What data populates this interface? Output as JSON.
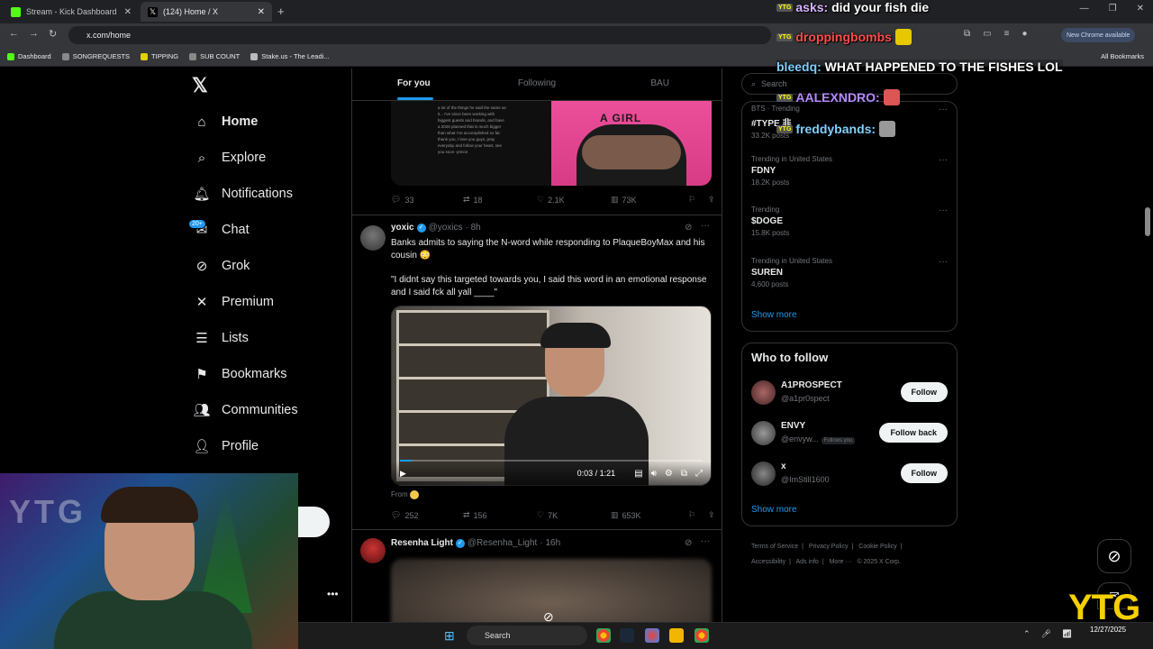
{
  "browser": {
    "tabs": [
      {
        "title": "Stream - Kick Dashboard",
        "color": "#53fc18"
      },
      {
        "title": "(124) Home / X",
        "color": "#ffffff"
      }
    ],
    "url": "x.com/home",
    "new_chrome": "New Chrome available",
    "bookmarks": [
      "Dashboard",
      "SONGREQUESTS",
      "TIPPING",
      "SUB COUNT",
      "Stake.us - The Leadi..."
    ],
    "all_bookmarks": "All Bookmarks"
  },
  "nav": {
    "items": [
      {
        "label": "Home",
        "icon": "home-icon"
      },
      {
        "label": "Explore",
        "icon": "search-icon"
      },
      {
        "label": "Notifications",
        "icon": "bell-icon"
      },
      {
        "label": "Chat",
        "icon": "mail-icon"
      },
      {
        "label": "Grok",
        "icon": "grok-icon"
      },
      {
        "label": "Premium",
        "icon": "x-icon"
      },
      {
        "label": "Lists",
        "icon": "list-icon"
      },
      {
        "label": "Bookmarks",
        "icon": "bookmark-icon"
      },
      {
        "label": "Communities",
        "icon": "people-icon"
      },
      {
        "label": "Profile",
        "icon": "person-icon"
      }
    ],
    "chat_badge": "20+"
  },
  "feed": {
    "tabs": [
      "For you",
      "Following",
      "BAU"
    ],
    "top_post": {
      "image_text": "a lot of the things he said the same as it... I've since been working with biggest guests and brands, and have a 2026 planned that is much bigger than what I've accomplished so far. thank you, I love you guys, pray everyday and follow your heart, see you soon -prince",
      "shirt_text": "A GIRL",
      "replies": "33",
      "reposts": "18",
      "likes": "2.1K",
      "views": "73K"
    },
    "tweet": {
      "name": "yoxic",
      "handle": "@yoxics",
      "time": "· 8h",
      "text": "Banks admits to saying the N-word while responding to PlaqueBoyMax and his cousin 😳",
      "quote": "\"I didnt say this targeted towards you, I said this word in an emotional response and I said fck all yall ____\"",
      "video_time": "0:03 / 1:21",
      "video_progress": 0.04,
      "from_label": "From",
      "replies": "252",
      "reposts": "156",
      "likes": "7K",
      "views": "653K"
    },
    "tweet2": {
      "name": "Resenha Light",
      "handle": "@Resenha_Light",
      "time": "· 16h"
    }
  },
  "sidebar": {
    "search_placeholder": "Search",
    "trends": [
      {
        "context": "BTS · Trending",
        "title": "#TYPE 非",
        "count": "33.2K posts"
      },
      {
        "context": "Trending in United States",
        "title": "FDNY",
        "count": "18.2K posts"
      },
      {
        "context": "Trending",
        "title": "$DOGE",
        "count": "15.8K posts"
      },
      {
        "context": "Trending in United States",
        "title": "SUREN",
        "count": "4,600 posts"
      }
    ],
    "show_more": "Show more",
    "who_to_follow_title": "Who to follow",
    "who_to_follow": [
      {
        "name": "A1PROSPECT",
        "handle": "@a1pr0spect",
        "button": "Follow",
        "follows_you": ""
      },
      {
        "name": "ENVY",
        "handle": "@envyw...",
        "button": "Follow back",
        "follows_you": "Follows you"
      },
      {
        "name": "x",
        "handle": "@ImStill1600",
        "button": "Follow",
        "follows_you": ""
      }
    ],
    "show_more_2": "Show more",
    "footer": [
      "Terms of Service",
      "|",
      "Privacy Policy",
      "|",
      "Cookie Policy",
      "|",
      "Accessibility",
      "|",
      "Ads info",
      "|",
      "More ···",
      "© 2025 X Corp."
    ]
  },
  "stream_chat": [
    {
      "user": "asks:",
      "message": "did your fish die",
      "badge": "YTG"
    },
    {
      "user": "droppingbombs",
      "message": "",
      "badge": "YTG"
    },
    {
      "user": "bleedq:",
      "message": "WHAT HAPPENED TO THE FISHES LOL",
      "badge": ""
    },
    {
      "user": "AALEXNDRO:",
      "message": "",
      "badge": "YTG"
    },
    {
      "user": "freddybands:",
      "message": "",
      "badge": "YTG"
    }
  ],
  "stream": {
    "webcam_text": "YTG",
    "logo": "YTG"
  },
  "taskbar": {
    "search": "Search",
    "date": "12/27/2025"
  }
}
